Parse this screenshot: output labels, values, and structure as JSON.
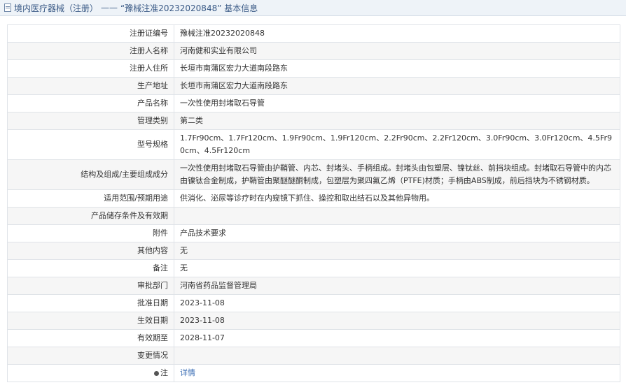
{
  "header": {
    "category": "境内医疗器械（注册）",
    "separator": "——",
    "record_title": "“豫械注准20232020848” 基本信息"
  },
  "rows": [
    {
      "label": "注册证编号",
      "value": "豫械注准20232020848"
    },
    {
      "label": "注册人名称",
      "value": "河南健和实业有限公司"
    },
    {
      "label": "注册人住所",
      "value": "长垣市南蒲区宏力大道南段路东"
    },
    {
      "label": "生产地址",
      "value": "长垣市南蒲区宏力大道南段路东"
    },
    {
      "label": "产品名称",
      "value": "一次性使用封堵取石导管"
    },
    {
      "label": "管理类别",
      "value": "第二类"
    },
    {
      "label": "型号规格",
      "value": "1.7Fr90cm、1.7Fr120cm、1.9Fr90cm、1.9Fr120cm、2.2Fr90cm、2.2Fr120cm、3.0Fr90cm、3.0Fr120cm、4.5Fr90cm、4.5Fr120cm"
    },
    {
      "label": "结构及组成/主要组成成分",
      "value": "一次性使用封堵取石导管由护鞘管、内芯、封堵头、手柄组成。封堵头由包塑层、镍钛丝、前挡块组成。封堵取石导管中的内芯由镍钛合金制成，护鞘管由聚醚醚酮制成，包塑层为聚四氟乙烯（PTFE)材质；手柄由ABS制成，前后挡块为不锈钢材质。"
    },
    {
      "label": "适用范围/预期用途",
      "value": "供消化、泌尿等诊疗时在内窥镜下抓住、操控和取出结石以及其他异物用。"
    },
    {
      "label": "产品储存条件及有效期",
      "value": ""
    },
    {
      "label": "附件",
      "value": "产品技术要求"
    },
    {
      "label": "其他内容",
      "value": "无"
    },
    {
      "label": "备注",
      "value": "无"
    },
    {
      "label": "审批部门",
      "value": "河南省药品监督管理局"
    },
    {
      "label": "批准日期",
      "value": "2023-11-08"
    },
    {
      "label": "生效日期",
      "value": "2023-11-08"
    },
    {
      "label": "有效期至",
      "value": "2028-11-07"
    },
    {
      "label": "变更情况",
      "value": ""
    },
    {
      "label": "注",
      "value": "详情"
    }
  ]
}
